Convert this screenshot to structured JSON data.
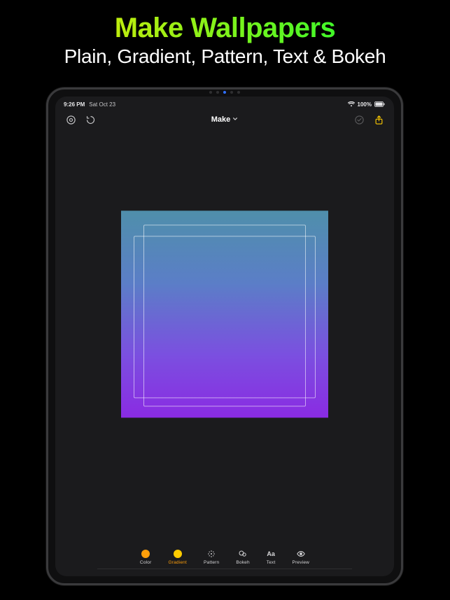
{
  "promo": {
    "title": "Make Wallpapers",
    "subtitle": "Plain, Gradient, Pattern, Text & Bokeh"
  },
  "status": {
    "time": "9:26 PM",
    "date": "Sat Oct 23",
    "battery_pct": "100%"
  },
  "navbar": {
    "title": "Make"
  },
  "toolbar": {
    "items": [
      {
        "id": "color",
        "label": "Color",
        "color": "#ff9f0a",
        "active": false
      },
      {
        "id": "gradient",
        "label": "Gradient",
        "color": "#ffcc00",
        "active": true
      },
      {
        "id": "pattern",
        "label": "Pattern",
        "color": "",
        "active": false
      },
      {
        "id": "bokeh",
        "label": "Bokeh",
        "color": "",
        "active": false
      },
      {
        "id": "text",
        "label": "Text",
        "color": "",
        "active": false
      },
      {
        "id": "preview",
        "label": "Preview",
        "color": "",
        "active": false
      }
    ]
  },
  "canvas": {
    "gradient_top": "#4f8fab",
    "gradient_bottom": "#8a2be2"
  }
}
